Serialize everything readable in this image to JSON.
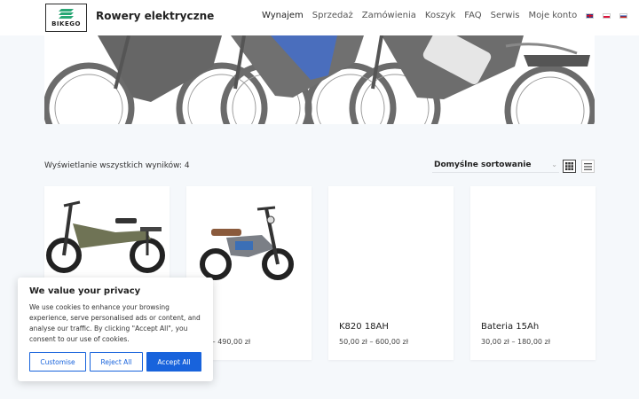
{
  "header": {
    "logo_text": "BIKEGO",
    "site_title": "Rowery elektryczne",
    "nav": [
      {
        "label": "Wynajem",
        "active": true
      },
      {
        "label": "Sprzedaż"
      },
      {
        "label": "Zamówienia"
      },
      {
        "label": "Koszyk"
      },
      {
        "label": "FAQ"
      },
      {
        "label": "Serwis"
      },
      {
        "label": "Moje konto"
      }
    ],
    "languages": [
      "en-flag-icon",
      "pl-flag-icon",
      "ru-flag-icon"
    ]
  },
  "shop": {
    "result_count": "Wyświetlanie wszystkich wyników: 4",
    "sort_selected": "Domyślne sortowanie",
    "view_modes": [
      "grid-view-icon",
      "list-view-icon"
    ]
  },
  "products": [
    {
      "title": "",
      "price": "",
      "has_image": true
    },
    {
      "title": "",
      "price": "0 zł – 490,00 zł",
      "has_image": true
    },
    {
      "title": "K820 18AH",
      "price": "50,00 zł – 600,00 zł",
      "has_image": false
    },
    {
      "title": "Bateria 15Ah",
      "price": "30,00 zł – 180,00 zł",
      "has_image": false
    }
  ],
  "cookie_banner": {
    "title": "We value your privacy",
    "text": "We use cookies to enhance your browsing experience, serve personalised ads or content, and analyse our traffic. By clicking \"Accept All\", you consent to our use of cookies.",
    "customise_label": "Customise",
    "reject_label": "Reject All",
    "accept_label": "Accept All"
  },
  "colors": {
    "accent": "#1863dc",
    "background": "#f5f8fb",
    "logo_green": "#2aa876"
  }
}
